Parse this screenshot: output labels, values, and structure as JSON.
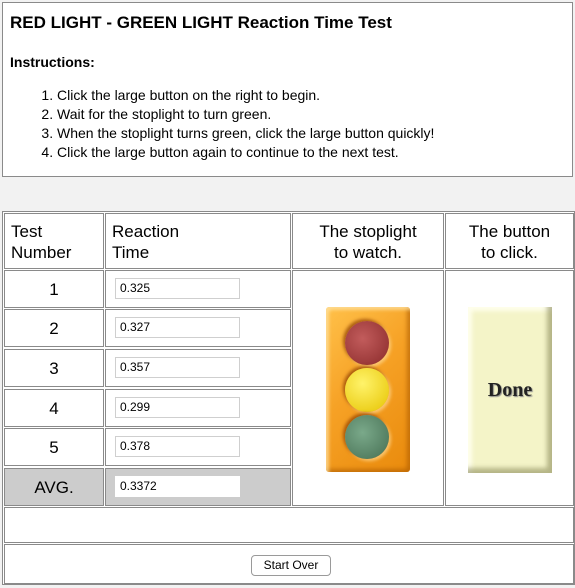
{
  "title": "RED LIGHT - GREEN LIGHT Reaction Time Test",
  "instructions": {
    "heading": "Instructions:",
    "steps": [
      "Click the large button on the right to begin.",
      "Wait for the stoplight to turn green.",
      "When the stoplight turns green, click the large button quickly!",
      "Click the large button again to continue to the next test."
    ]
  },
  "table": {
    "headers": {
      "test_l1": "Test",
      "test_l2": "Number",
      "reaction_l1": "Reaction",
      "reaction_l2": "Time",
      "stoplight_l1": "The stoplight",
      "stoplight_l2": "to watch.",
      "button_l1": "The button",
      "button_l2": "to click."
    },
    "rows": [
      {
        "number": "1",
        "time": "0.325"
      },
      {
        "number": "2",
        "time": "0.327"
      },
      {
        "number": "3",
        "time": "0.357"
      },
      {
        "number": "4",
        "time": "0.299"
      },
      {
        "number": "5",
        "time": "0.378"
      }
    ],
    "avg_label": "AVG.",
    "avg_value": "0.3372"
  },
  "stoplight": {
    "active_lamp": "yellow"
  },
  "done_button": "Done",
  "start_over": "Start Over",
  "colors": {
    "stoplight_body": "#f6a125",
    "lamp_red": "#8a2a2a",
    "lamp_yellow": "#f5dc00",
    "lamp_green": "#4f7d5e",
    "done_button": "#f4f4c8",
    "avg_row": "#cccccc"
  }
}
